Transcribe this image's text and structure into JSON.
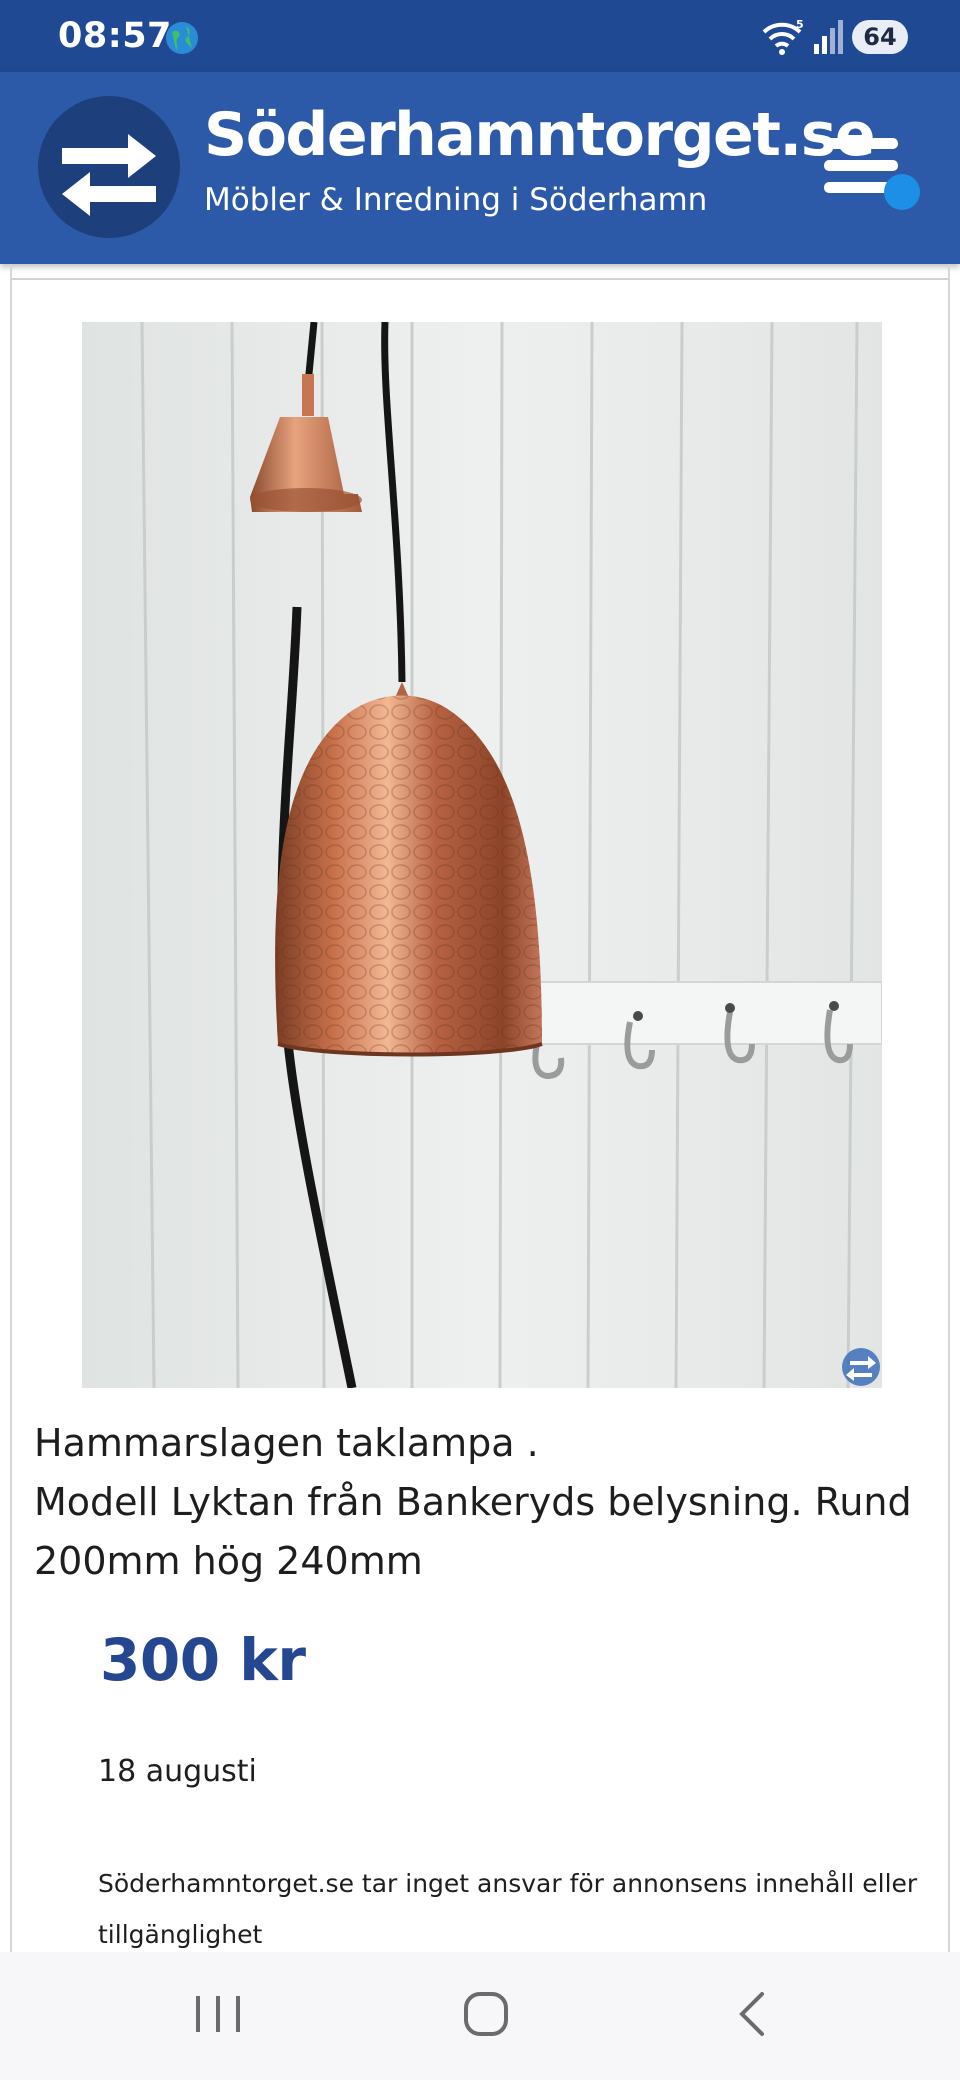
{
  "status_bar": {
    "time": "08:57",
    "battery": "64",
    "icons": [
      "globe-icon",
      "wifi-icon",
      "signal-icon",
      "battery-icon"
    ]
  },
  "header": {
    "site_title": "Söderhamntorget.se",
    "tagline": "Möbler & Inredning i Söderhamn",
    "logo_icon": "swap-arrows-icon",
    "menu_icon": "hamburger-menu-icon"
  },
  "listing": {
    "description_lines": [
      "Hammarslagen taklampa .",
      "Modell Lyktan från Bankeryds belysning. Rund",
      "200mm hög 240mm"
    ],
    "price": "300 kr",
    "date": "18 augusti",
    "disclaimer": "Söderhamntorget.se tar inget ansvar för annonsens innehåll eller tillgänglighet"
  },
  "colors": {
    "status_bar": "#1f4a93",
    "header": "#2d5aa8",
    "logo_circle": "#1d3f7c",
    "accent_dot": "#1d8fe6",
    "price": "#24478f"
  },
  "nav_bar": {
    "icons": [
      "recent-apps-icon",
      "home-icon",
      "back-icon"
    ]
  }
}
